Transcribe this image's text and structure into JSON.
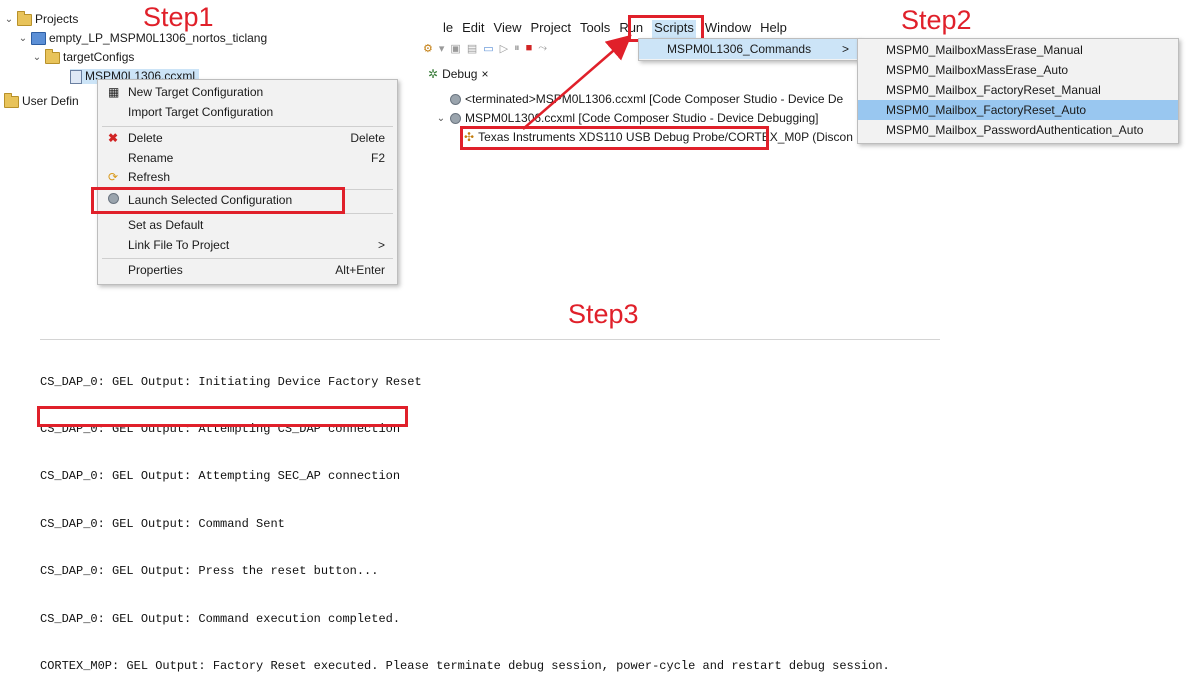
{
  "steps": {
    "step1": "Step1",
    "step2": "Step2",
    "step3": "Step3"
  },
  "project_explorer": {
    "projects_label": "Projects",
    "project_name": "empty_LP_MSPM0L1306_nortos_ticlang",
    "target_configs": "targetConfigs",
    "ccxml_file": "MSPM0L1306.ccxml",
    "user_defined": "User Defin"
  },
  "context_menu": {
    "items": [
      {
        "label": "New Target Configuration",
        "shortcut": ""
      },
      {
        "label": "Import Target Configuration",
        "shortcut": ""
      },
      {
        "label": "Delete",
        "shortcut": "Delete"
      },
      {
        "label": "Rename",
        "shortcut": "F2"
      },
      {
        "label": "Refresh",
        "shortcut": ""
      },
      {
        "label": "Launch Selected Configuration",
        "shortcut": ""
      },
      {
        "label": "Set as Default",
        "shortcut": ""
      },
      {
        "label": "Link File To Project",
        "shortcut": ">"
      },
      {
        "label": "Properties",
        "shortcut": "Alt+Enter"
      }
    ]
  },
  "menubar": {
    "file": "le",
    "edit": "Edit",
    "view": "View",
    "project": "Project",
    "tools": "Tools",
    "run": "Run",
    "scripts": "Scripts",
    "window": "Window",
    "help": "Help"
  },
  "scripts_menu": {
    "item": "MSPM0L1306_Commands",
    "arrow": ">"
  },
  "commands_submenu": {
    "items": [
      "MSPM0_MailboxMassErase_Manual",
      "MSPM0_MailboxMassErase_Auto",
      "MSPM0_Mailbox_FactoryReset_Manual",
      "MSPM0_Mailbox_FactoryReset_Auto",
      "MSPM0_Mailbox_PasswordAuthentication_Auto"
    ],
    "selected_index": 3
  },
  "debug_view": {
    "tab_label": "Debug",
    "tab_close": "×",
    "terminated": "<terminated>MSPM0L1306.ccxml [Code Composer Studio - Device De",
    "session": "MSPM0L1306.ccxml [Code Composer Studio - Device Debugging]",
    "probe": "Texas Instruments XDS110 USB Debug Probe/CORTEX_M0P (Discon"
  },
  "console": {
    "lines": [
      "CS_DAP_0: GEL Output: Initiating Device Factory Reset",
      "CS_DAP_0: GEL Output: Attempting CS_DAP connection",
      "CS_DAP_0: GEL Output: Attempting SEC_AP connection",
      "CS_DAP_0: GEL Output: Command Sent",
      "CS_DAP_0: GEL Output: Press the reset button...",
      "CS_DAP_0: GEL Output: Command execution completed.",
      "CORTEX_M0P: GEL Output: Factory Reset executed. Please terminate debug session, power-cycle and restart debug session."
    ]
  },
  "colors": {
    "annotation_red": "#e0202a",
    "selection_blue": "#99c7f0",
    "hover_blue": "#cce4f7"
  }
}
